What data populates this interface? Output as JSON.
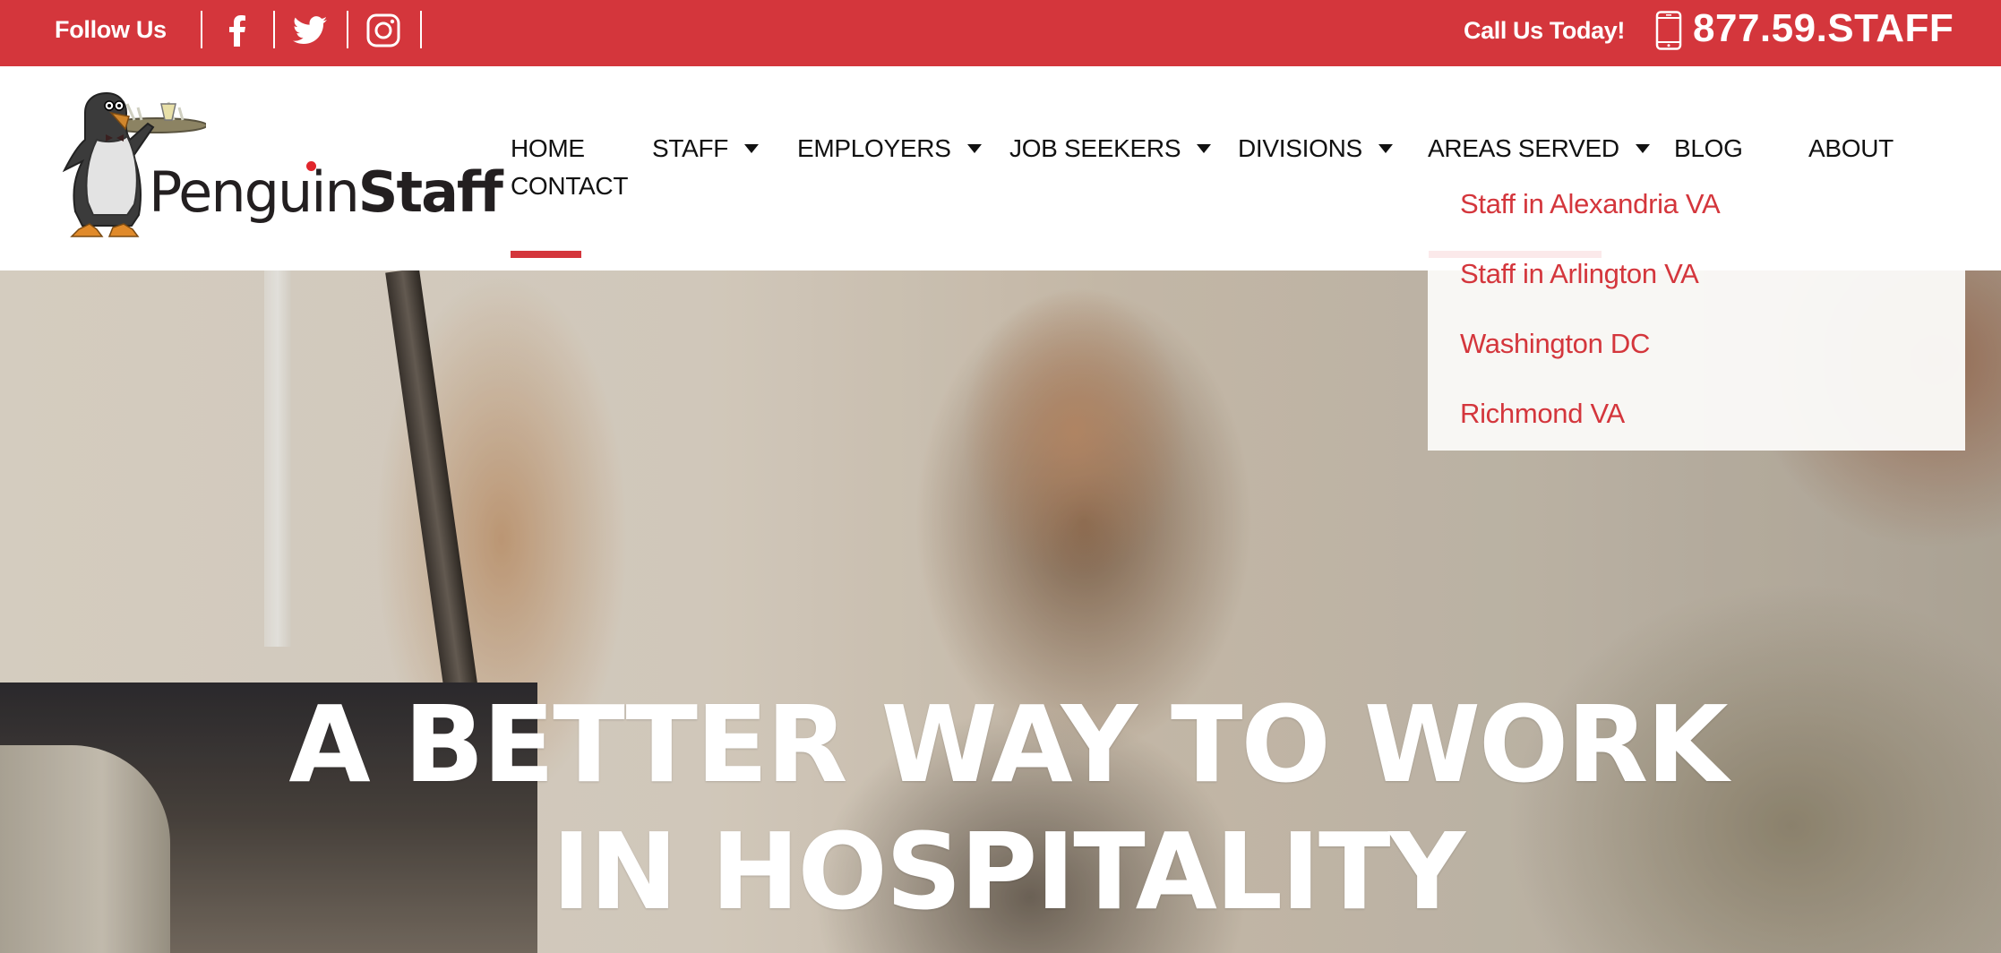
{
  "topbar": {
    "follow_label": "Follow Us",
    "social": [
      {
        "name": "facebook",
        "icon": "facebook-icon"
      },
      {
        "name": "twitter",
        "icon": "twitter-icon"
      },
      {
        "name": "instagram",
        "icon": "instagram-icon"
      }
    ],
    "call_label": "Call Us Today!",
    "phone_icon": "mobile-phone-icon",
    "phone_number": "877.59.STAFF"
  },
  "logo": {
    "text_light": "Penguin",
    "text_bold": "Staff",
    "alt": "PenguinStaff"
  },
  "nav": {
    "items": [
      {
        "label": "HOME",
        "has_dropdown": false,
        "active": true
      },
      {
        "label": "STAFF",
        "has_dropdown": true
      },
      {
        "label": "EMPLOYERS",
        "has_dropdown": true
      },
      {
        "label": "JOB SEEKERS",
        "has_dropdown": true
      },
      {
        "label": "DIVISIONS",
        "has_dropdown": true
      },
      {
        "label": "AREAS SERVED",
        "has_dropdown": true,
        "open": true
      },
      {
        "label": "BLOG",
        "has_dropdown": false
      },
      {
        "label": "ABOUT",
        "has_dropdown": false
      },
      {
        "label": "CONTACT",
        "has_dropdown": false
      }
    ]
  },
  "areas_dropdown": {
    "items": [
      "Staff in Alexandria VA",
      "Staff in Arlington VA",
      "Washington DC",
      "Richmond VA"
    ]
  },
  "hero": {
    "title_line1": "A BETTER WAY TO WORK",
    "title_line2": "IN HOSPITALITY"
  },
  "colors": {
    "brand_red": "#d4363c",
    "nav_text": "#111111",
    "dropdown_bg": "#faf9f7",
    "hover_underline": "#fbe9ea"
  }
}
